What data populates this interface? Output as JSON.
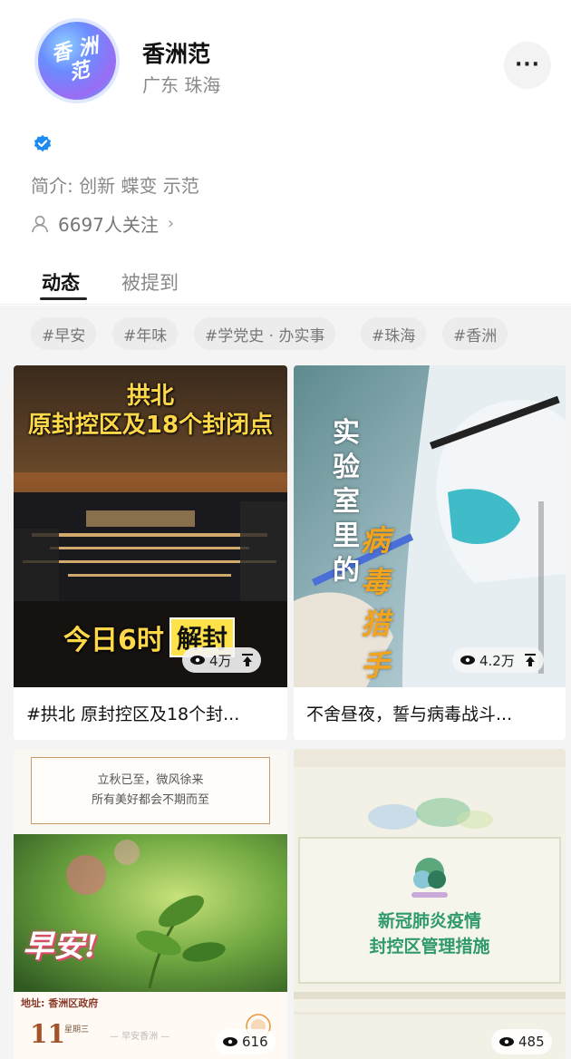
{
  "profile": {
    "avatar_text": [
      "香",
      "洲",
      "范"
    ],
    "name": "香洲范",
    "location": "广东 珠海",
    "more_label": "···",
    "bio": "简介: 创新 蝶变 示范",
    "followers": "6697人关注",
    "followers_chevron": "›"
  },
  "tabs": [
    {
      "label": "动态",
      "active": true
    },
    {
      "label": "被提到",
      "active": false
    }
  ],
  "tags": [
    "#早安",
    "#年味",
    "#学党史 · 办实事",
    "#珠海",
    "#香洲"
  ],
  "posts": [
    {
      "overlay_title": [
        "拱北",
        "原封控区及18个封闭点"
      ],
      "overlay_bottom": [
        "今日6时",
        "解封"
      ],
      "views": "4万",
      "pinned": true,
      "caption": "#拱北 原封控区及18个封..."
    },
    {
      "vertical_white": [
        "实",
        "验",
        "室",
        "里",
        "的"
      ],
      "vertical_orange": [
        "病",
        "毒",
        "猎",
        "手"
      ],
      "views": "4.2万",
      "pinned": true,
      "caption": "不舍昼夜，誓与病毒战斗..."
    },
    {
      "box_line1": "立秋已至，微风徐来",
      "box_line2": "所有美好都会不期而至",
      "overlay": "早安!",
      "address": "地址: 香洲区政府",
      "date_num": "11",
      "date_small": "星期三",
      "footer_mid": "— 早安香洲 —",
      "views": "616",
      "pinned": false
    },
    {
      "box_line1": "新冠肺炎疫情",
      "box_line2": "封控区管理措施",
      "views": "485",
      "pinned": false
    }
  ],
  "colors": {
    "accent_blue": "#1d8cf0",
    "overlay_yellow": "#ffd84a",
    "orange": "#f2a51c",
    "green_text": "#2f9a6a"
  }
}
